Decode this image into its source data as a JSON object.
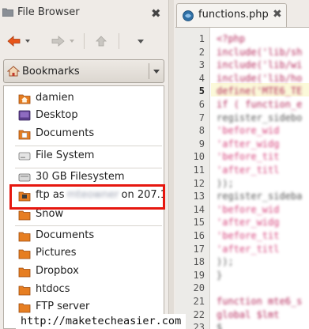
{
  "file_browser": {
    "title": "File Browser",
    "bookmarks_combo_label": "Bookmarks",
    "items": [
      {
        "label": "damien",
        "icon": "home-folder-icon"
      },
      {
        "label": "Desktop",
        "icon": "desktop-icon"
      },
      {
        "label": "Documents",
        "icon": "documents-folder-icon"
      },
      {
        "label": "File System",
        "icon": "harddisk-icon"
      },
      {
        "label": "30 GB Filesystem",
        "icon": "drive-icon"
      },
      {
        "label_prefix": "ftp as",
        "label_hidden": "mteowner",
        "label_suffix": "on 207.1",
        "icon": "network-drive-icon"
      },
      {
        "label": "Snow",
        "icon": "folder-icon"
      },
      {
        "label": "Documents",
        "icon": "folder-icon"
      },
      {
        "label": "Pictures",
        "icon": "folder-icon"
      },
      {
        "label": "Dropbox",
        "icon": "folder-icon"
      },
      {
        "label": "htdocs",
        "icon": "folder-icon"
      },
      {
        "label": "FTP server",
        "icon": "folder-icon"
      }
    ]
  },
  "editor": {
    "tab_label": "functions.php",
    "current_line": "5",
    "line_numbers": [
      "1",
      "2",
      "3",
      "4",
      "5",
      "6",
      "7",
      "8",
      "9",
      "10",
      "11",
      "12",
      "13",
      "14",
      "15",
      "16",
      "17",
      "18",
      "19",
      "20",
      "21",
      "22",
      "23"
    ],
    "code_lines": [
      "<?php",
      "include('lib/sh",
      "include('lib/wi",
      "include('lib/ho",
      "define('MTE6_TE",
      "if ( function_e",
      "register_sidebo",
      "    'before_wid",
      "    'after_widg",
      "    'before_tit",
      "    'after_titl",
      "    ));",
      "register_sideba",
      "    'before_wid",
      "    'after_widg",
      "    'before_tit",
      "    'after_titl",
      "    ));",
      "}",
      "",
      "function mte6_s",
      "    global $lmt",
      "    $"
    ]
  },
  "watermark": "http://maketecheasier.com",
  "colors": {
    "highlight_border": "#e6170f",
    "code_string": "#d6407a",
    "code_keyword": "#b5275a",
    "code_plain": "#555555"
  }
}
